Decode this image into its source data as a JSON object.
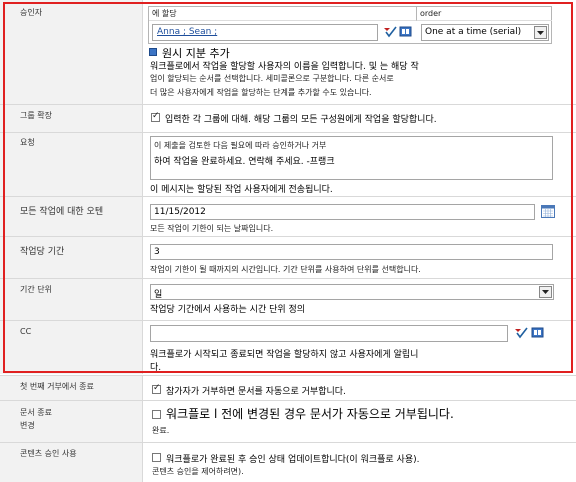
{
  "approvers": {
    "label": "승인자",
    "assign_to_header": "에 할당",
    "order_header": "order",
    "people_value": "Anna ; Sean ;",
    "order_value": "One at a time (serial)",
    "add_stage_label": "원시 지분 추가",
    "help_lines": [
      "워크플로에서 작업을 할당할 사용자의 이름을 입력합니다. 및 는 해당 작",
      "업이 할당되는 순서를 선택합니다. 세미콜론으로 구분합니다. 다른 순서로",
      "더 많은 사용자에게 작업을 할당하는 단계를 추가할 수도 있습니다."
    ]
  },
  "expand_groups": {
    "label": "그룹 확장",
    "checkbox_text": "입력한 각 그룹에 대해. 해당 그룹의 모든 구성원에게 작업을 할당합니다.",
    "checked": true
  },
  "request": {
    "label": "요청",
    "text_lines": [
      "이 제출을 검토한 다음 필요에 따라 승인하거나 거부",
      "하여 작업을 완료하세요. 연락해 주세요. -프랭크"
    ],
    "help": "이 메시지는 할당된 작업 사용자에게 전송됩니다."
  },
  "due_date": {
    "label": "모든 작업에 대한 오텐",
    "value": "11/15/2012",
    "help": "모든 작업이 기한이 되는 날짜입니다."
  },
  "duration": {
    "label": "작업당 기간",
    "value": "3",
    "help": "작업이 기한이 될 때까지의 시간입니다. 기간 단위를 사용하여 단위를 선택합니다."
  },
  "duration_units": {
    "label": "기간 단위",
    "value": "일",
    "help": "작업당 기간에서 사용하는 시간 단위 정의"
  },
  "cc": {
    "label": "CC",
    "value": "",
    "help_lines": [
      "워크플로가 시작되고 종료되면 작업을 할당하지 않고 사용자에게 알립니",
      "다."
    ]
  },
  "end_on_first_reject": {
    "label": "첫 번째 거부에서 종료",
    "checkbox_text": "참가자가 거부하면 문서를 자동으로 거부합니다.",
    "checked": true
  },
  "end_on_doc_change": {
    "label_lines": [
      "문서 종료",
      "변경"
    ],
    "checkbox_text": "워크플로 l 전에 변경된 경우 문서가 자동으로 거부됩니다.",
    "sub_text": "완료.",
    "checked": false
  },
  "content_approval": {
    "label": "콘텐츠 승인 사용",
    "checkbox_text": "워크플로가 완료된 후 승인 상태 업데이트합니다(이 워크플로 사용).",
    "sub_text": "콘텐츠 승인을 제어하려면).",
    "checked": false
  },
  "colors": {
    "highlight_border": "#e02020",
    "label_bg": "#f2f2f2",
    "link_blue": "#1f4f9c"
  },
  "icons": [
    "check-names-icon",
    "address-book-icon",
    "calendar-icon",
    "dropdown-arrow-icon",
    "add-stage-icon"
  ]
}
